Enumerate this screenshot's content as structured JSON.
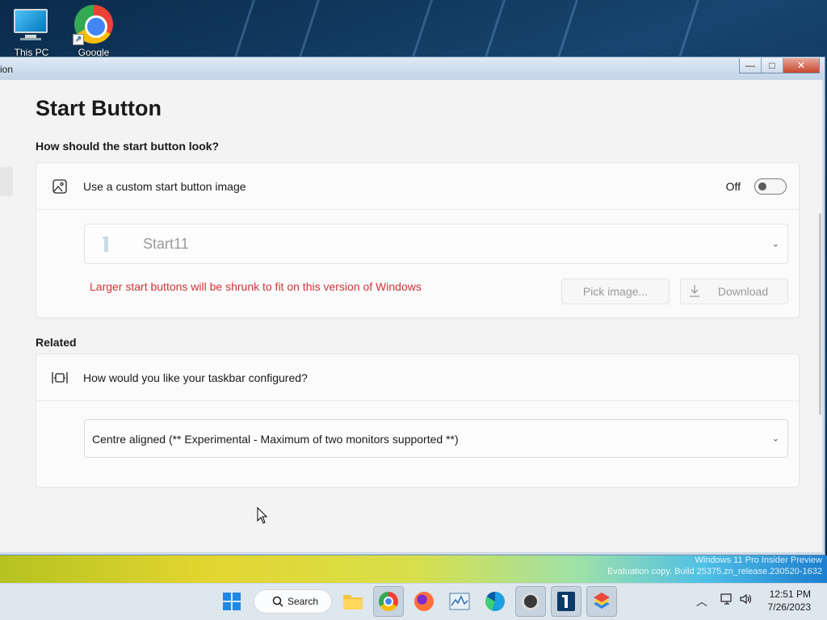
{
  "desktop": {
    "icons": [
      {
        "label": "This PC",
        "icon": "this-pc-icon"
      },
      {
        "label": "Google",
        "icon": "chrome-shortcut-icon"
      }
    ]
  },
  "window": {
    "title_partial": "ion",
    "controls": {
      "minimize": "—",
      "maximize": "□",
      "close": "✕"
    }
  },
  "page": {
    "title": "Start Button",
    "look_section": {
      "heading": "How should the start button look?",
      "custom_image_label": "Use a custom start button image",
      "toggle_state": "Off",
      "toggle_on": false,
      "selected_button": "Start11",
      "warning": "Larger start buttons will be shrunk to fit on this version of Windows",
      "pick_image_label": "Pick image...",
      "download_label": "Download",
      "warning_color": "#d13438"
    },
    "related_section": {
      "heading": "Related",
      "taskbar_question": "How would you like your taskbar configured?",
      "taskbar_selected": "Centre aligned (** Experimental - Maximum of two monitors supported **)"
    }
  },
  "watermark": {
    "line1": "Windows 11 Pro Insider Preview",
    "line2": "Evaluation copy. Build 25375.zn_release.230520-1632"
  },
  "taskbar": {
    "search_label": "Search",
    "apps": [
      "windows-start-icon",
      "file-explorer-icon",
      "chrome-icon",
      "firefox-icon",
      "performance-monitor-icon",
      "edge-icon",
      "obs-icon",
      "start11-icon",
      "bluestacks-icon"
    ],
    "time": "12:51 PM",
    "date": "7/26/2023"
  }
}
